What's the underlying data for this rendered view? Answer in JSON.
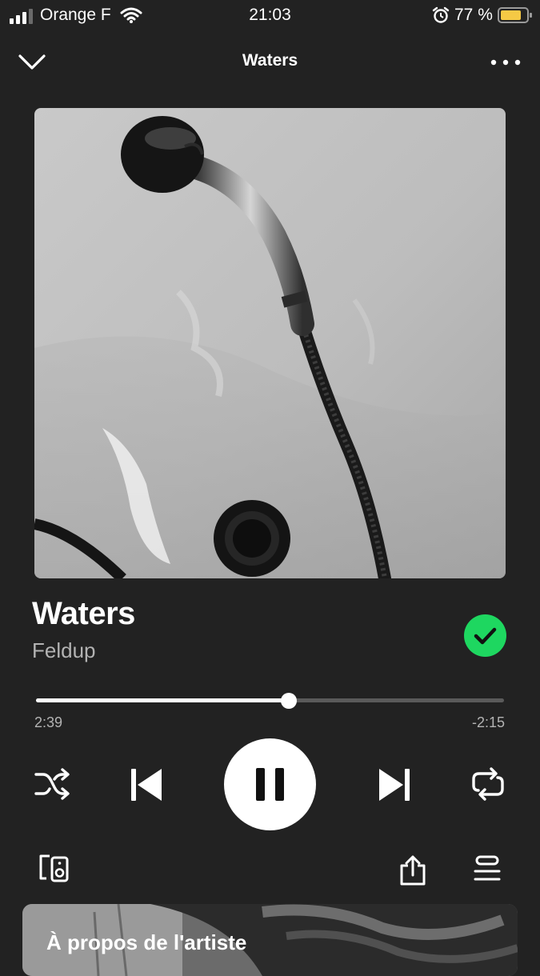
{
  "status_bar": {
    "carrier": "Orange F",
    "time": "21:03",
    "battery": "77 %"
  },
  "header": {
    "title": "Waters"
  },
  "track": {
    "title": "Waters",
    "artist": "Feldup",
    "liked": true
  },
  "playback": {
    "elapsed": "2:39",
    "remaining": "-2:15",
    "progress": 0.54,
    "state": "playing"
  },
  "about": {
    "title": "À propos de l'artiste"
  },
  "colors": {
    "background": "#222222",
    "accent": "#1ed760",
    "secondary_text": "#b3b3b3"
  },
  "icons": {
    "header_left": "chevron-down-icon",
    "header_right": "more-icon",
    "liked": "check-icon",
    "shuffle": "shuffle-icon",
    "previous": "skip-previous-icon",
    "play_pause": "pause-icon",
    "next": "skip-next-icon",
    "repeat": "repeat-icon",
    "devices": "devices-icon",
    "share": "share-icon",
    "queue": "queue-icon"
  }
}
